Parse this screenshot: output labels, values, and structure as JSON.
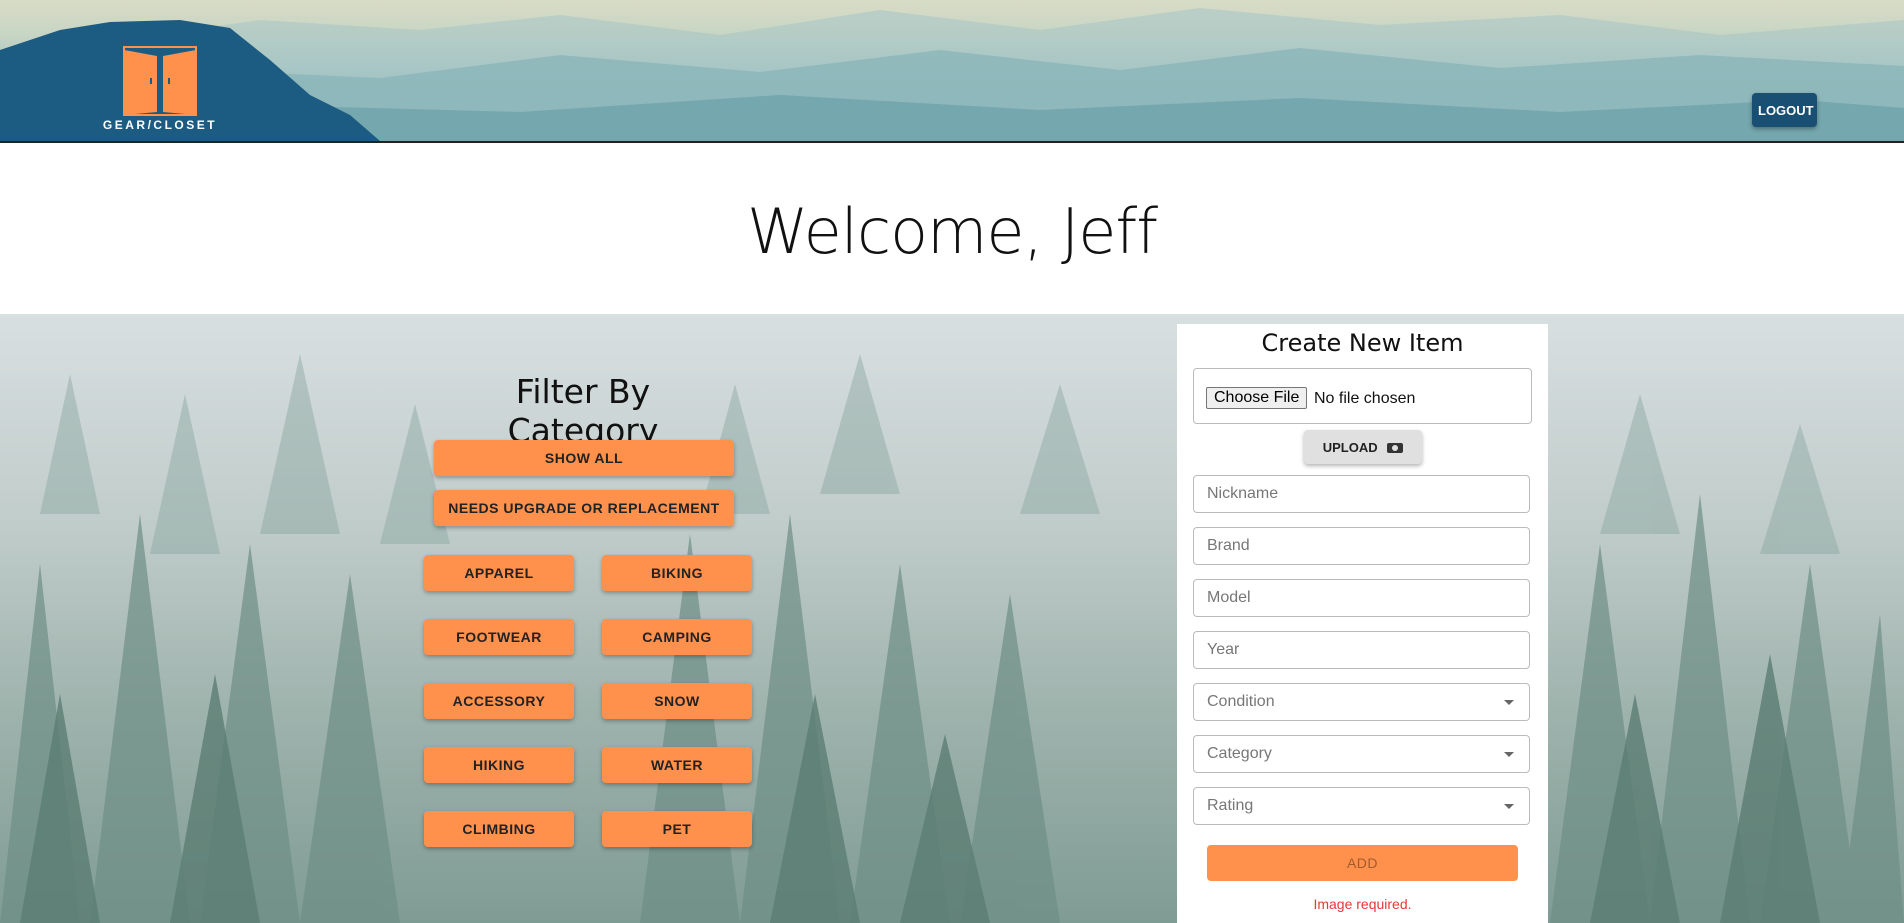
{
  "header": {
    "logo_text": "GEAR/CLOSET",
    "logout_label": "LOGOUT"
  },
  "welcome": "Welcome, Jeff",
  "filter": {
    "title": "Filter By Category",
    "show_all": "SHOW ALL",
    "needs_upgrade": "NEEDS UPGRADE OR REPLACEMENT",
    "categories": [
      "APPAREL",
      "BIKING",
      "FOOTWEAR",
      "CAMPING",
      "ACCESSORY",
      "SNOW",
      "HIKING",
      "WATER",
      "CLIMBING",
      "PET"
    ]
  },
  "create": {
    "title": "Create New Item",
    "choose_file": "Choose File",
    "no_file": "No file chosen",
    "upload": "UPLOAD",
    "nickname": "Nickname",
    "brand": "Brand",
    "model": "Model",
    "year": "Year",
    "condition": "Condition",
    "category": "Category",
    "rating": "Rating",
    "add": "ADD",
    "error": "Image required."
  },
  "colors": {
    "accent": "#ff914d",
    "logout": "#1a4f74",
    "error": "#e53935"
  }
}
